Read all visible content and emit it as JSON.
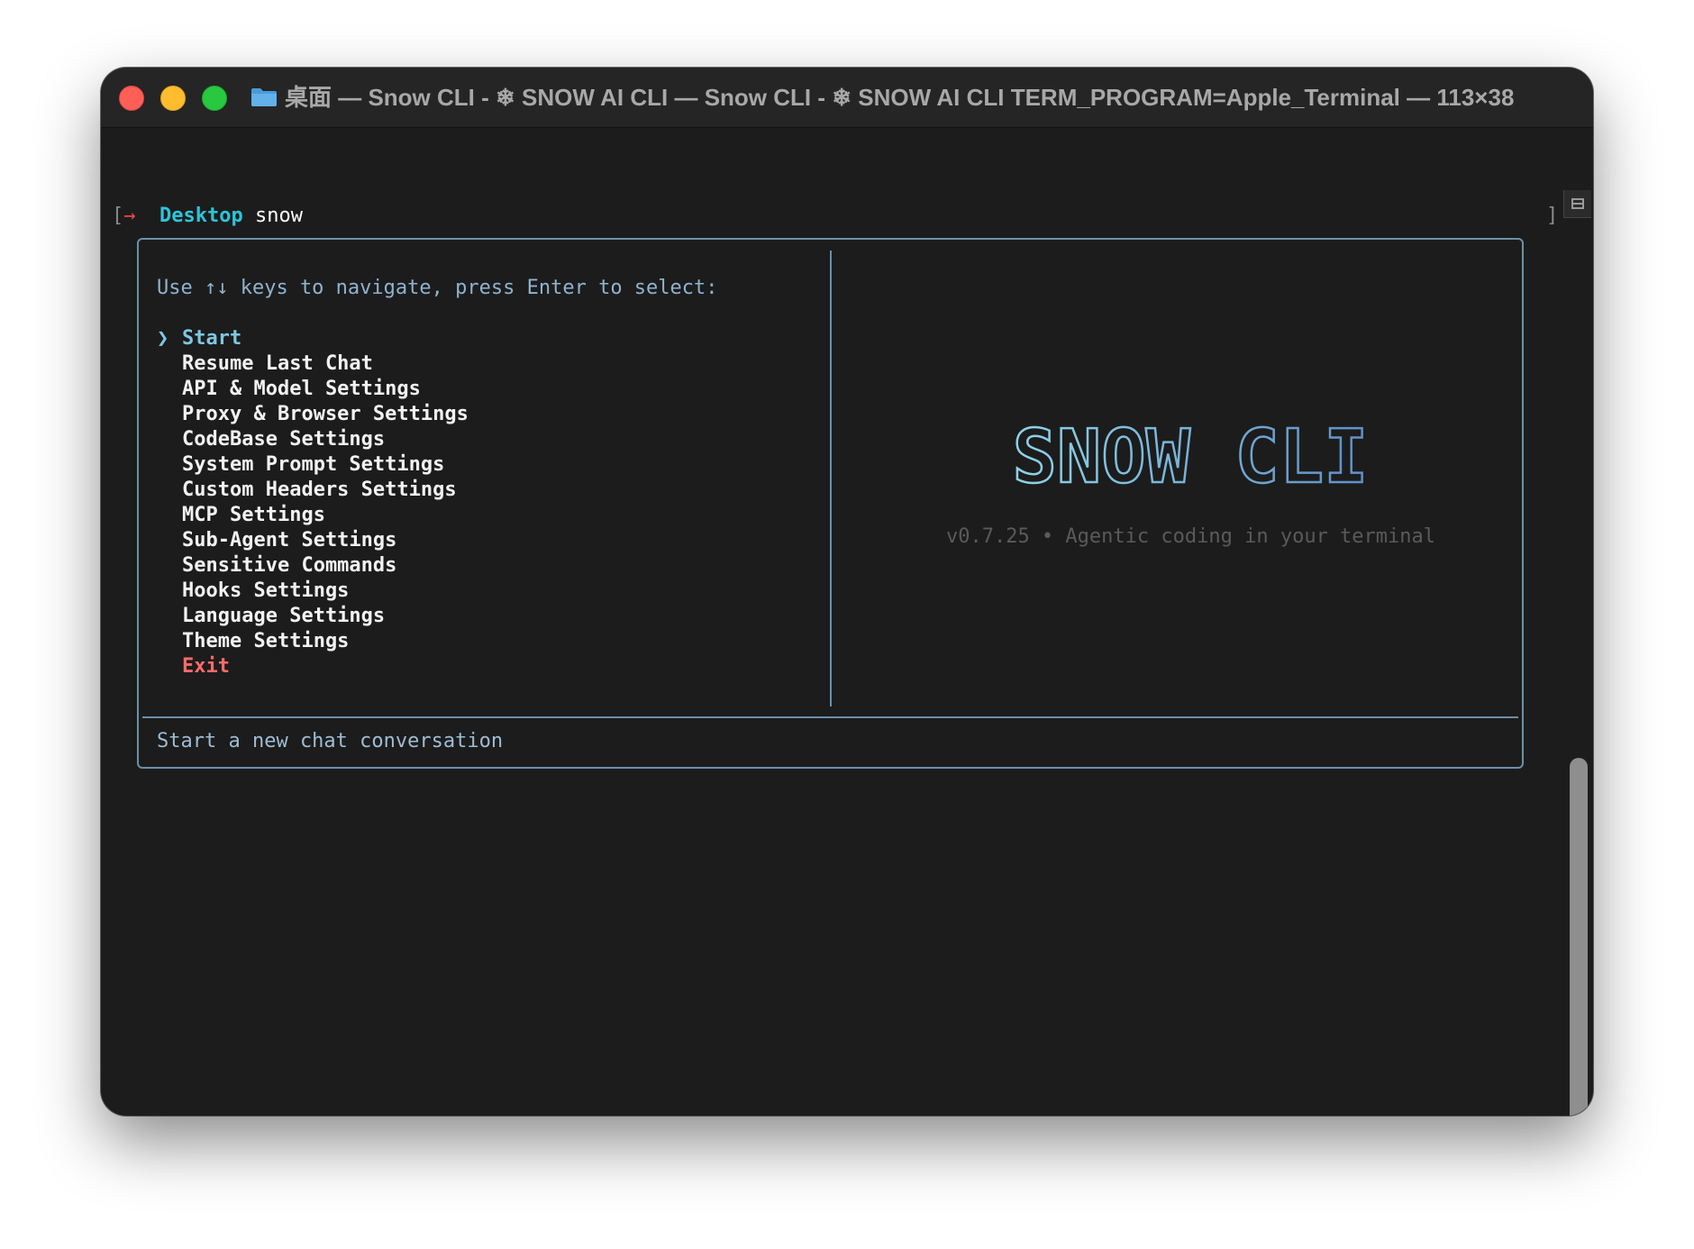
{
  "window": {
    "title": "桌面 — Snow CLI - ❄ SNOW AI CLI — Snow CLI - ❄ SNOW AI CLI TERM_PROGRAM=Apple_Terminal — 113×38"
  },
  "prompt": {
    "bracket_open": "[",
    "arrow": "→",
    "directory": "Desktop",
    "command": "snow",
    "bracket_close": "]"
  },
  "menu": {
    "instructions": "Use ↑↓ keys to navigate, press Enter to select:",
    "cursor": "❯",
    "items": [
      {
        "label": "Start",
        "selected": true
      },
      {
        "label": "Resume Last Chat"
      },
      {
        "label": "API & Model Settings"
      },
      {
        "label": "Proxy & Browser Settings"
      },
      {
        "label": "CodeBase Settings"
      },
      {
        "label": "System Prompt Settings"
      },
      {
        "label": "Custom Headers Settings"
      },
      {
        "label": "MCP Settings"
      },
      {
        "label": "Sub-Agent Settings"
      },
      {
        "label": "Sensitive Commands"
      },
      {
        "label": "Hooks Settings"
      },
      {
        "label": "Language Settings"
      },
      {
        "label": "Theme Settings"
      },
      {
        "label": "Exit",
        "danger": true
      }
    ],
    "description": "Start a new chat conversation"
  },
  "splash": {
    "logo_text": "SNOW CLI",
    "version_line": "v0.7.25 • Agentic coding in your terminal"
  },
  "colors": {
    "accent": "#7ec8e3",
    "danger": "#ff6b6b",
    "border": "#6c8fa8",
    "directory": "#2ec4d8"
  }
}
